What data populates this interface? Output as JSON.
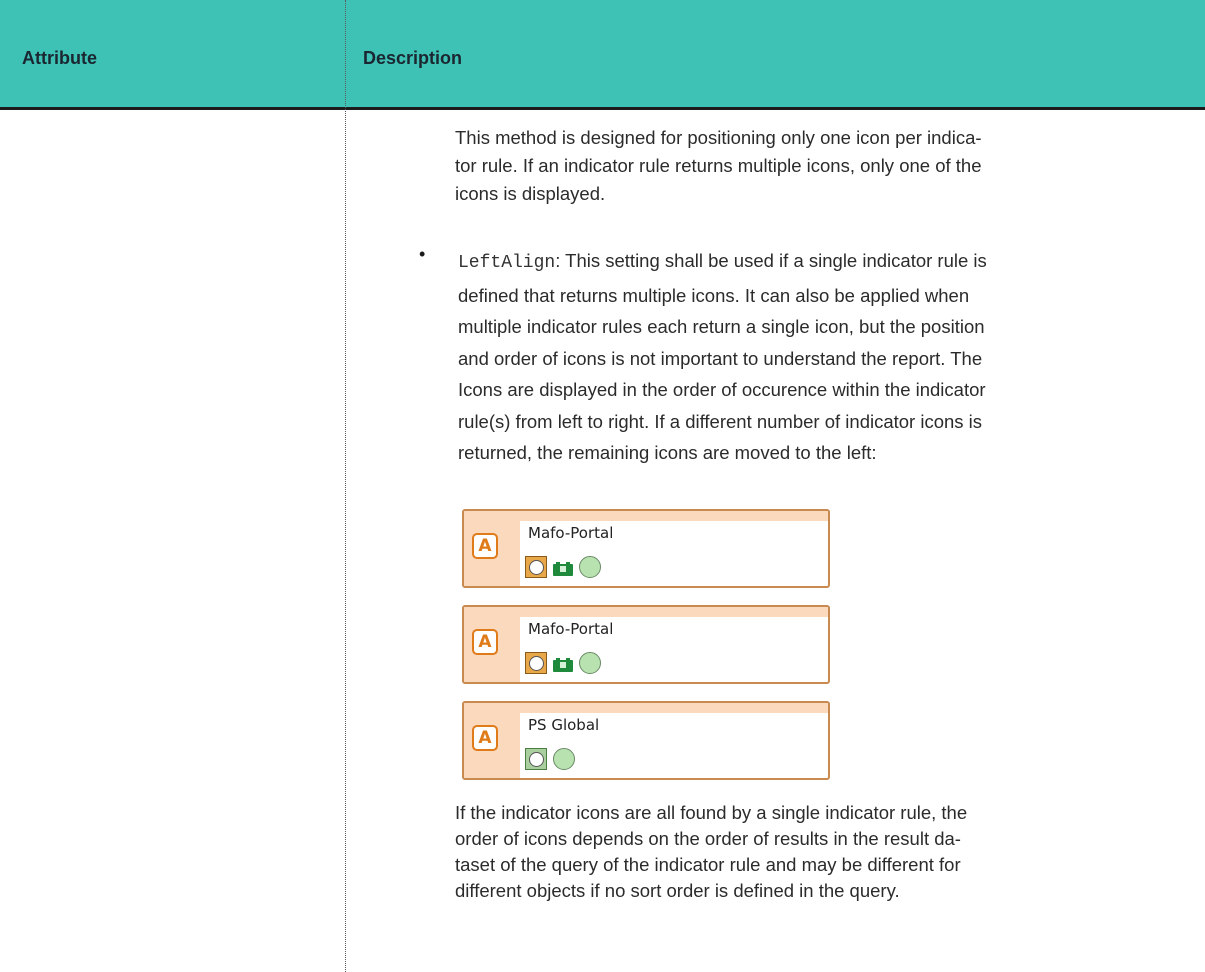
{
  "table": {
    "header": {
      "col1": "Attribute",
      "col2": "Description"
    }
  },
  "content": {
    "para1": [
      "This method is designed for positioning only one icon per indica-",
      "tor rule. If an indicator rule returns multiple icons, only one of the",
      "icons is displayed."
    ],
    "bullet": "•",
    "bullet_code": "LeftAlign",
    "bullet_first_line": ": This setting shall be used if a single indicator rule is",
    "bullet_lines": [
      "defined that returns multiple icons. It can also be applied when",
      "multiple indicator rules each return a single icon, but the position",
      "and order of icons is not important to understand the report. The",
      "Icons are displayed in the order of occurence within the indicator",
      "rule(s) from left to right. If a different number of indicator icons is",
      "returned, the remaining icons are moved to the left:"
    ],
    "para3": [
      "If the indicator icons are all found by a single indicator rule, the",
      "order of icons depends on the order of results in the result da-",
      "taset of the query of the indicator rule and may be different for",
      "different objects if no sort order is defined in the query."
    ]
  },
  "example": {
    "boxes": [
      {
        "type_letter": "A",
        "name": "Mafo-Portal",
        "icons": [
          "sad-face-icon",
          "battery-icon",
          "green-circle-icon"
        ]
      },
      {
        "type_letter": "A",
        "name": "Mafo-Portal",
        "icons": [
          "sad-face-icon",
          "battery-icon",
          "green-circle-icon"
        ]
      },
      {
        "type_letter": "A",
        "name": "PS Global",
        "icons": [
          "happy-face-icon",
          "green-circle-icon"
        ]
      }
    ],
    "colors": {
      "header_bg": "#3fc2b6",
      "box_border": "#c98a4f",
      "box_band": "#fad9bd",
      "type_icon": "#e07b1a"
    }
  }
}
